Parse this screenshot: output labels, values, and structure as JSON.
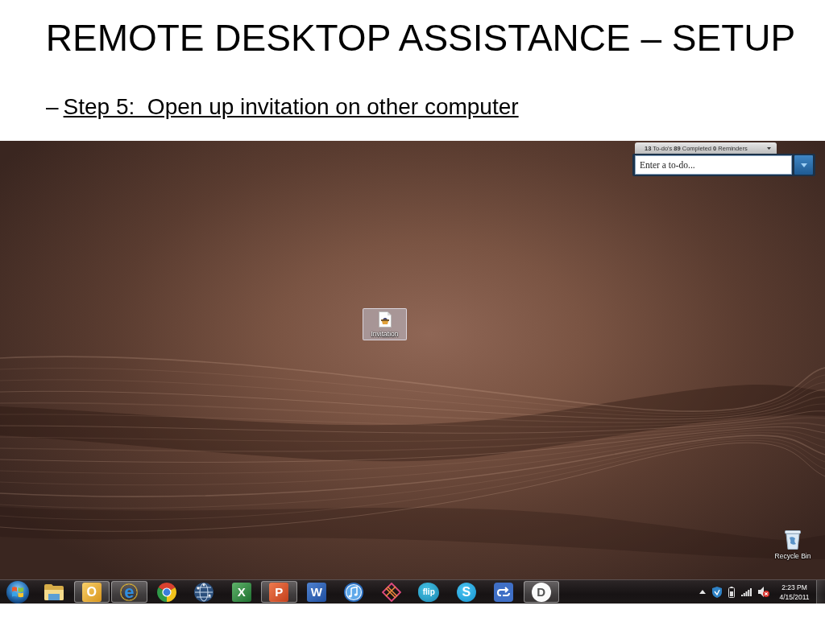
{
  "slide": {
    "title": "REMOTE DESKTOP ASSISTANCE – SETUP",
    "bullet": {
      "marker": "–",
      "text": "Step 5:  Open up invitation on other computer"
    }
  },
  "todo_widget": {
    "summary": "**13** To-do's **89** Completed **0** Reminders",
    "input": {
      "placeholder": "Enter a to-do..."
    }
  },
  "desktop_icons": [
    {
      "kind": "document",
      "label": "Invitation",
      "selected": true
    },
    {
      "kind": "recycle-bin",
      "label": "Recycle Bin",
      "selected": false
    }
  ],
  "taskbar": {
    "buttons": [
      {
        "kind": "folder",
        "running": false
      },
      {
        "kind": "mail",
        "glyph": "O",
        "running": true
      },
      {
        "kind": "browser",
        "glyph": "e",
        "running": true
      },
      {
        "kind": "ring",
        "running": false
      },
      {
        "kind": "globe",
        "running": false
      },
      {
        "kind": "spreadsheet",
        "glyph": "X",
        "running": false
      },
      {
        "kind": "slides",
        "glyph": "P",
        "running": true
      },
      {
        "kind": "document",
        "glyph": "W",
        "running": false
      },
      {
        "kind": "music",
        "running": false
      },
      {
        "kind": "knot",
        "running": false
      },
      {
        "kind": "flip",
        "glyph": "flip",
        "running": false
      },
      {
        "kind": "chat",
        "glyph": "S",
        "running": false
      },
      {
        "kind": "arrows",
        "running": false
      },
      {
        "kind": "disc",
        "glyph": "D",
        "running": true
      }
    ],
    "tray": {
      "icons": [
        {
          "kind": "show-hidden"
        },
        {
          "kind": "shield"
        },
        {
          "kind": "battery"
        },
        {
          "kind": "signal"
        },
        {
          "kind": "speaker",
          "muted": true
        }
      ],
      "time": "2:23 PM",
      "date": "4/15/2011"
    }
  }
}
